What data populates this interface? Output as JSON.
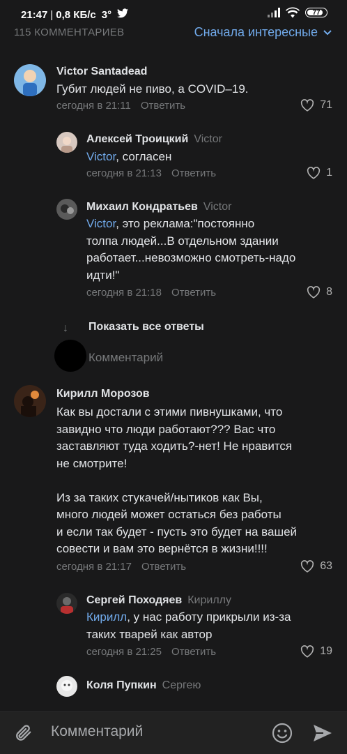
{
  "status": {
    "time": "21:47",
    "speed": "0,8 КБ/с",
    "temp": "3°",
    "twitter_icon": "twitter-icon",
    "battery": "77"
  },
  "header": {
    "count": "115 КОММЕНТАРИЕВ",
    "sort": "Сначала интересные"
  },
  "comments": [
    {
      "name": "Victor Santadead",
      "reply_to": "",
      "mention": "",
      "text": "Губит людей не пиво, а COVID–19.",
      "time": "сегодня в 21:11",
      "reply": "Ответить",
      "likes": "71"
    },
    {
      "name": "Алексей Троицкий",
      "reply_to": "Victor",
      "mention": "Victor",
      "text": ", согласен",
      "time": "сегодня в 21:13",
      "reply": "Ответить",
      "likes": "1"
    },
    {
      "name": "Михаил Кондратьев",
      "reply_to": "Victor",
      "mention": "Victor",
      "text": ", это реклама:\"постоянно\nтолпа людей...В отдельном здании\nработает...невозможно смотреть-надо\nидти!\"",
      "time": "сегодня в 21:18",
      "reply": "Ответить",
      "likes": "8"
    },
    {
      "name": "Кирилл Морозов",
      "reply_to": "",
      "mention": "",
      "text": "Как вы достали с этими пивнушками, что\nзавидно что люди работают??? Вас что\nзаставляют туда ходить?-нет! Не нравится\nне смотрите!\n\nИз за таких стукачей/нытиков как Вы,\nмного людей может остаться без работы\nи если так будет - пусть это будет на вашей\nсовести и вам это вернётся в жизни!!!!",
      "time": "сегодня в 21:17",
      "reply": "Ответить",
      "likes": "63"
    },
    {
      "name": "Сергей Походяев",
      "reply_to": "Кириллу",
      "mention": "Кирилл",
      "text": ", у нас работу прикрыли из-за\nтаких тварей как автор",
      "time": "сегодня в 21:25",
      "reply": "Ответить",
      "likes": "19"
    },
    {
      "name": "Коля Пупкин",
      "reply_to": "Сергею",
      "mention": "",
      "text": "",
      "time": "",
      "reply": "",
      "likes": ""
    }
  ],
  "show_all": "Показать все ответы",
  "inline_placeholder": "Комментарий",
  "bottom_placeholder": "Комментарий",
  "colors": {
    "accent": "#71aaeb",
    "background": "#19191a",
    "secondary": "#76787a"
  }
}
